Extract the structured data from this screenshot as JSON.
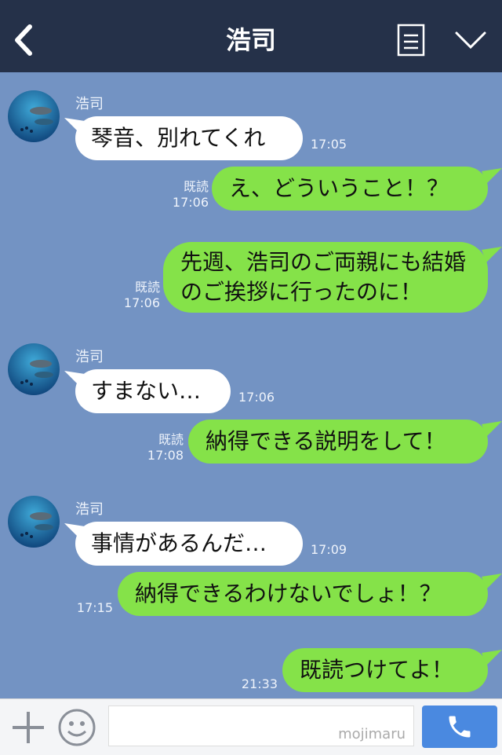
{
  "header": {
    "title": "浩司"
  },
  "messages": [
    {
      "name": "浩司",
      "text": "琴音、別れてくれ",
      "time": "17:05"
    },
    {
      "text": "え、どういうこと！？",
      "read": "既読",
      "time": "17:06"
    },
    {
      "text": "先週、浩司のご両親にも結婚のご挨拶に行ったのに！",
      "read": "既読",
      "time": "17:06"
    },
    {
      "name": "浩司",
      "text": "すまない…",
      "time": "17:06"
    },
    {
      "text": "納得できる説明をして！",
      "read": "既読",
      "time": "17:08"
    },
    {
      "name": "浩司",
      "text": "事情があるんだ…",
      "time": "17:09"
    },
    {
      "text": "納得できるわけないでしょ！？",
      "time": "17:15"
    },
    {
      "text": "既読つけてよ！",
      "time": "21:33"
    }
  ],
  "input": {
    "watermark": "mojimaru"
  },
  "colors": {
    "header": "#253149",
    "background": "#7393c3",
    "outgoing": "#85e249",
    "incoming": "#ffffff",
    "call_button": "#4a89e0"
  },
  "icons": {
    "back": "chevron-left-icon",
    "menu": "document-lines-icon",
    "expand": "chevron-down-icon",
    "add": "plus-icon",
    "sticker": "smiley-icon",
    "call": "phone-icon"
  }
}
